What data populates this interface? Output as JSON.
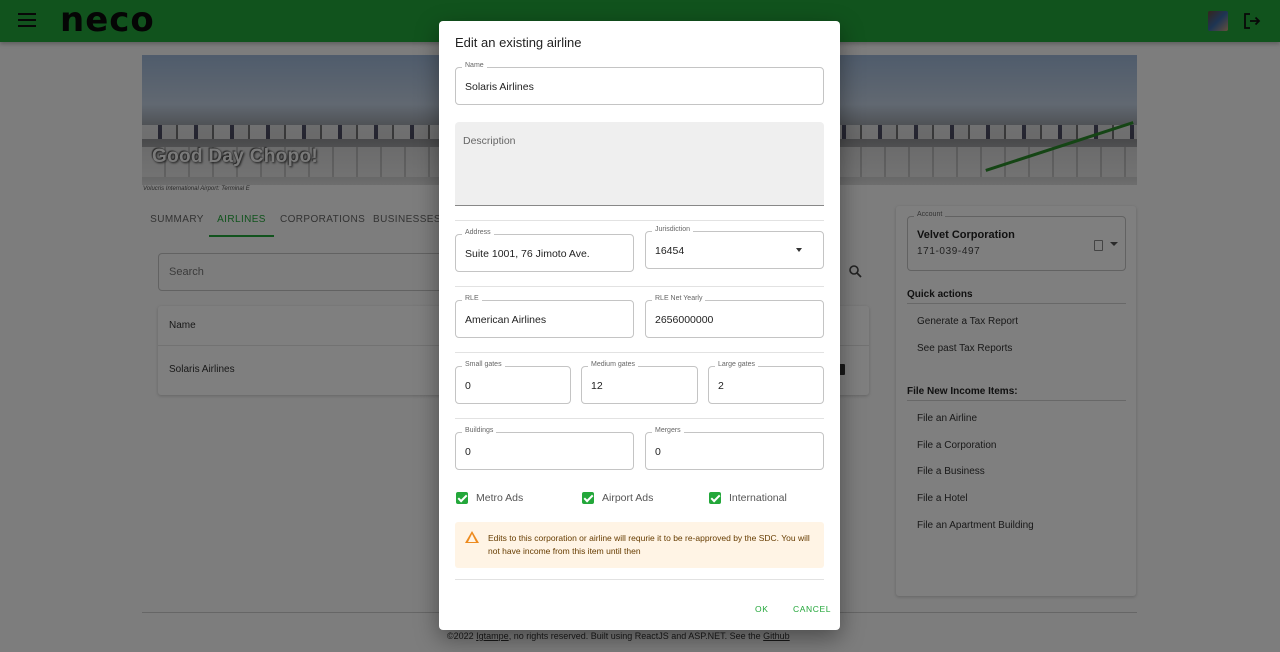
{
  "app": {
    "logo_text": "neco",
    "brand_color": "#23a73a",
    "icons": {
      "menu": "menu-icon",
      "logout": "logout-icon",
      "avatar": "user-avatar"
    }
  },
  "banner": {
    "title": "Good Day Chopo!",
    "caption": "Volucris International Airport: Terminal E"
  },
  "tabs": [
    {
      "label": "SUMMARY",
      "active": false
    },
    {
      "label": "AIRLINES",
      "active": true
    },
    {
      "label": "CORPORATIONS",
      "active": false
    },
    {
      "label": "BUSINESSES",
      "active": false
    }
  ],
  "search": {
    "placeholder": "Search"
  },
  "table": {
    "columns": [
      "Name"
    ],
    "rows": [
      [
        "Solaris Airlines"
      ]
    ]
  },
  "sidebar": {
    "account": {
      "label": "Account",
      "name": "Velvet Corporation",
      "number": "171-039-497"
    },
    "quick_actions": {
      "heading": "Quick actions",
      "items": [
        "Generate a Tax Report",
        "See past Tax Reports"
      ]
    },
    "income_items": {
      "heading": "File New Income Items:",
      "items": [
        "File an Airline",
        "File a Corporation",
        "File a Business",
        "File a Hotel",
        "File an Apartment Building"
      ]
    }
  },
  "footer": {
    "prefix": "©2022 ",
    "author": "Igtampe",
    "middle": ", no rights reserved. Built using ReactJS and ASP.NET. See the ",
    "link": "Github"
  },
  "dialog": {
    "title": "Edit an existing airline",
    "name": {
      "label": "Name",
      "value": "Solaris Airlines"
    },
    "description": {
      "placeholder": "Description",
      "value": ""
    },
    "address": {
      "label": "Address",
      "value": "Suite 1001, 76 Jimoto Ave."
    },
    "jurisdiction": {
      "label": "Jurisdiction",
      "value": "16454"
    },
    "rle": {
      "label": "RLE",
      "value": "American Airlines"
    },
    "rle_net_yearly": {
      "label": "RLE Net Yearly",
      "value": "2656000000"
    },
    "small_gates": {
      "label": "Small gates",
      "value": "0"
    },
    "medium_gates": {
      "label": "Medium gates",
      "value": "12"
    },
    "large_gates": {
      "label": "Large gates",
      "value": "2"
    },
    "buildings": {
      "label": "Buildings",
      "value": "0"
    },
    "mergers": {
      "label": "Mergers",
      "value": "0"
    },
    "checkboxes": [
      {
        "label": "Metro Ads",
        "checked": true
      },
      {
        "label": "Airport Ads",
        "checked": true
      },
      {
        "label": "International",
        "checked": true
      }
    ],
    "warning": "Edits to this corporation or airline will requrie it to be re-approved by the SDC. You will not have income from this item until then",
    "warning_color": "#ed8b1f",
    "ok_label": "OK",
    "cancel_label": "CANCEL"
  }
}
